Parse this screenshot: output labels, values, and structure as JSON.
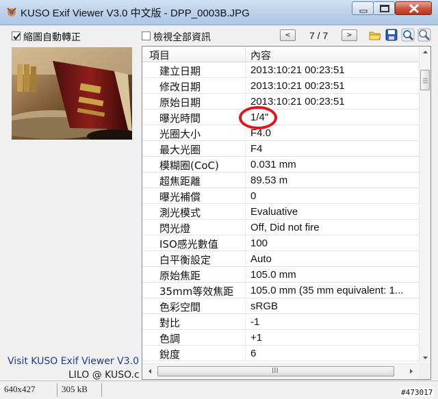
{
  "window": {
    "title": "KUSO Exif Viewer V3.0 中文版 - DPP_0003B.JPG",
    "icon": "kuso-app-icon",
    "controls": [
      "minimize-icon",
      "maximize-icon",
      "close-icon"
    ]
  },
  "toolbar": {
    "auto_rotate_label": "縮圖自動轉正",
    "auto_rotate_checked": true,
    "show_all_label": "檢視全部資訊",
    "show_all_checked": false,
    "prev_label": "<",
    "next_label": ">",
    "counter": "7 / 7",
    "tools": [
      "open-folder-icon",
      "save-icon",
      "magnifier-icon",
      "info-icon"
    ]
  },
  "left": {
    "visit_text": "Visit KUSO Exif Viewer V3.0",
    "credit_text": "LILO @ KUSO.c"
  },
  "table": {
    "header": {
      "key": "項目",
      "value": "內容"
    },
    "rows": [
      {
        "key": "建立日期",
        "value": "2013:10:21 00:23:51"
      },
      {
        "key": "修改日期",
        "value": "2013:10:21 00:23:51"
      },
      {
        "key": "原始日期",
        "value": "2013:10:21 00:23:51"
      },
      {
        "key": "曝光時間",
        "value": "1/4\""
      },
      {
        "key": "光圈大小",
        "value": "F4.0"
      },
      {
        "key": "最大光圈",
        "value": "F4"
      },
      {
        "key": "模糊圈(CoC)",
        "value": "0.031 mm"
      },
      {
        "key": "超焦距離",
        "value": "89.53 m"
      },
      {
        "key": "曝光補償",
        "value": "0"
      },
      {
        "key": "測光模式",
        "value": "Evaluative"
      },
      {
        "key": "閃光燈",
        "value": "Off, Did not fire"
      },
      {
        "key": "ISO感光數值",
        "value": "100"
      },
      {
        "key": "白平衡設定",
        "value": "Auto"
      },
      {
        "key": "原始焦距",
        "value": "105.0 mm"
      },
      {
        "key": "35mm等效焦距",
        "value": "105.0 mm (35 mm equivalent: 1..."
      },
      {
        "key": "色彩空間",
        "value": "sRGB"
      },
      {
        "key": "對比",
        "value": "-1"
      },
      {
        "key": "色調",
        "value": "+1"
      },
      {
        "key": "銳度",
        "value": "6"
      }
    ],
    "hscroll_grip": "III"
  },
  "status": {
    "dimensions": "640x427",
    "size": "305 kB"
  },
  "watermark": "#473017",
  "colors": {
    "highlight_circle": "#e0141a",
    "link": "#1f3b8c"
  }
}
